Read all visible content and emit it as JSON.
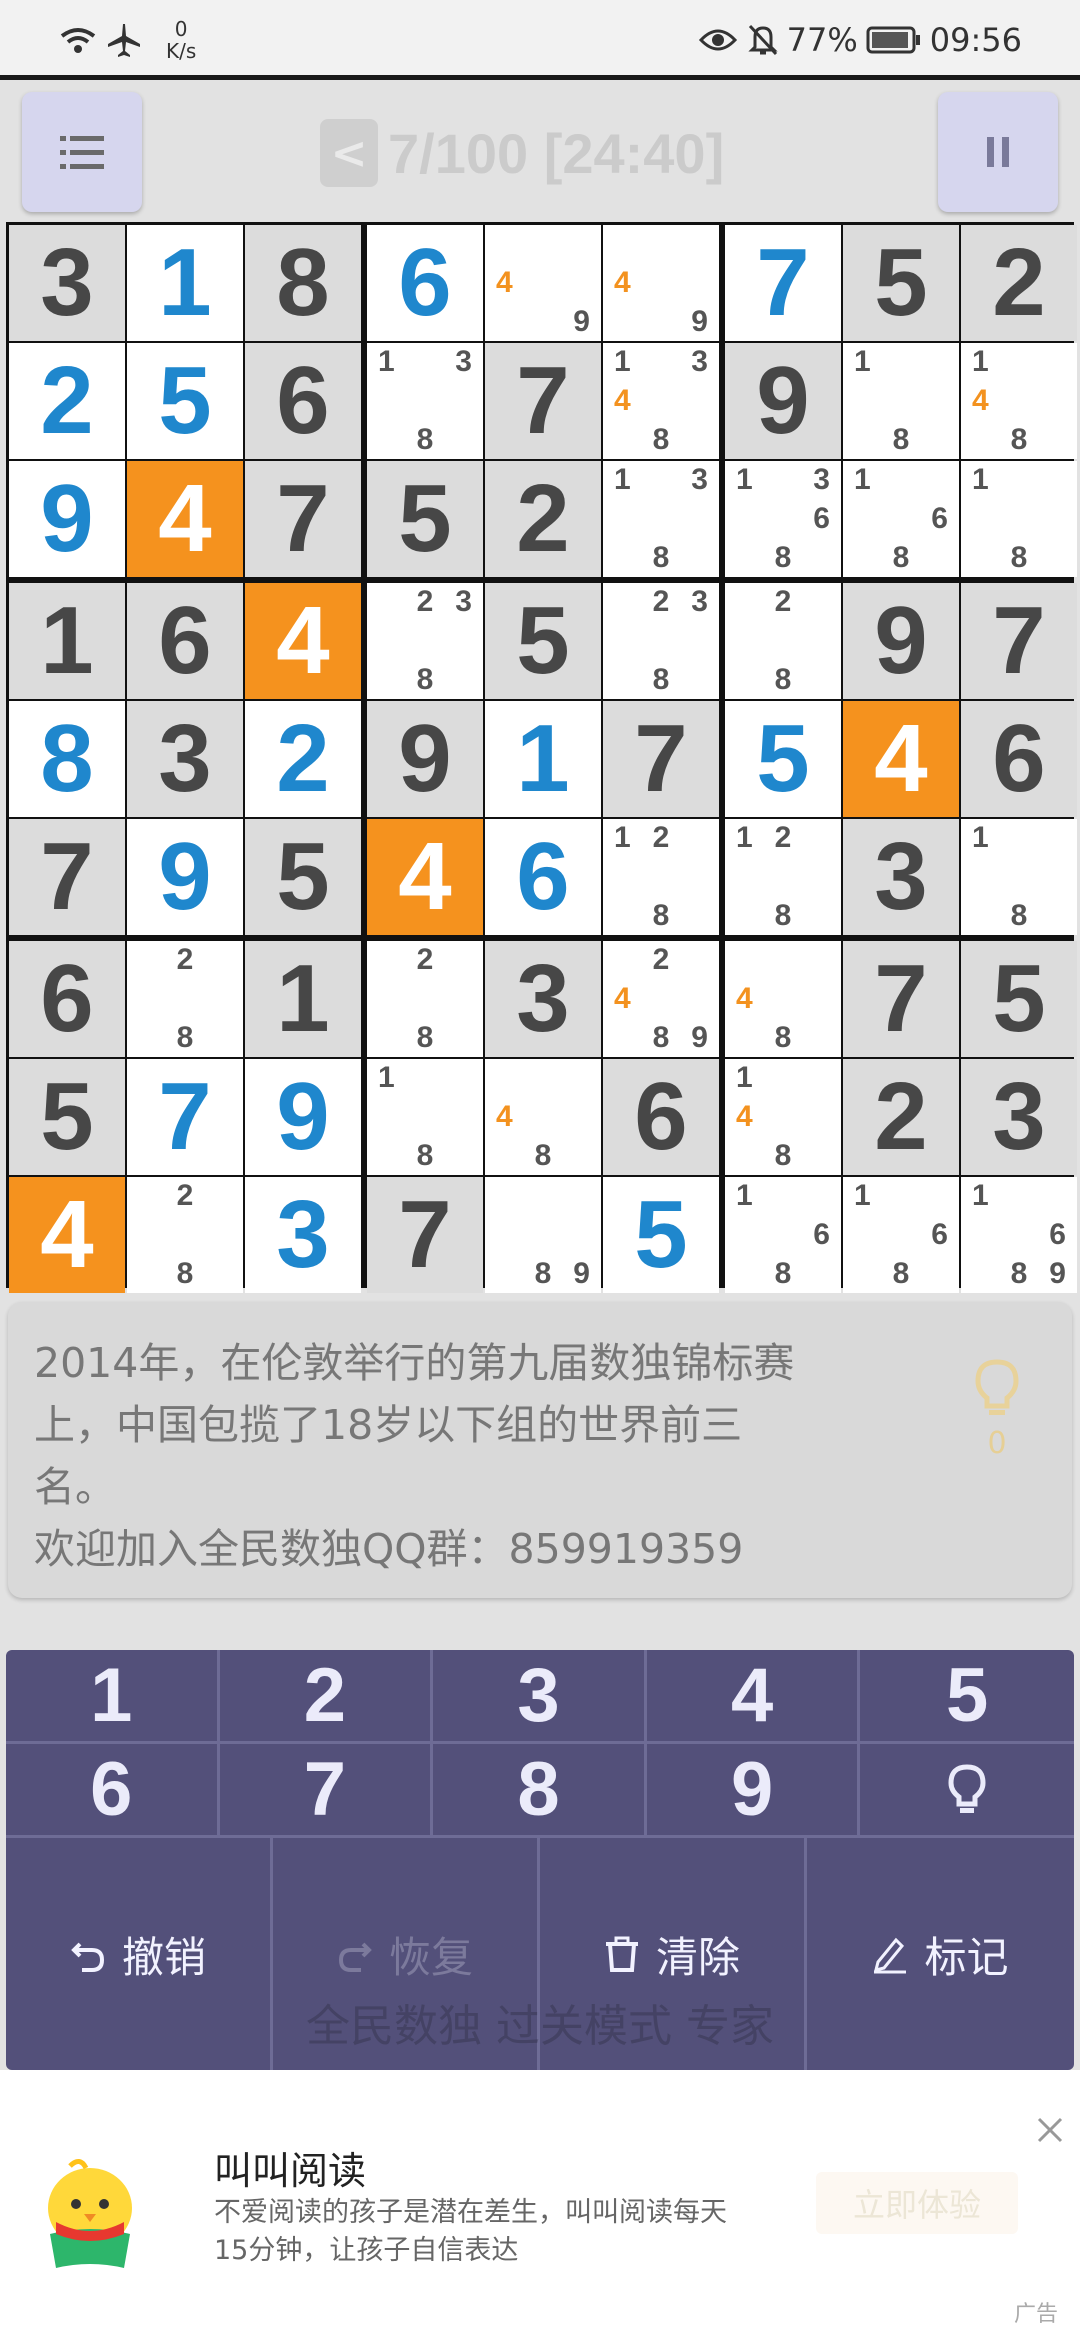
{
  "status_bar": {
    "net_speed_value": "0",
    "net_speed_unit": "K/s",
    "battery": "77%",
    "time": "09:56"
  },
  "header": {
    "back_label": "<",
    "progress": "7/100 [24:40]"
  },
  "board": {
    "cells": [
      [
        {
          "v": "3",
          "g": 1
        },
        {
          "v": "1",
          "u": 1
        },
        {
          "v": "8",
          "g": 1
        },
        {
          "v": "6",
          "u": 1
        },
        {
          "n": [
            4,
            9
          ]
        },
        {
          "n": [
            4,
            9
          ]
        },
        {
          "v": "7",
          "u": 1
        },
        {
          "v": "5",
          "g": 1
        },
        {
          "v": "2",
          "g": 1
        }
      ],
      [
        {
          "v": "2",
          "u": 1
        },
        {
          "v": "5",
          "u": 1
        },
        {
          "v": "6",
          "g": 1
        },
        {
          "n": [
            1,
            3,
            8
          ]
        },
        {
          "v": "7",
          "g": 1
        },
        {
          "n": [
            1,
            3,
            4,
            8
          ]
        },
        {
          "v": "9",
          "g": 1
        },
        {
          "n": [
            1,
            8
          ]
        },
        {
          "n": [
            1,
            4,
            8
          ]
        }
      ],
      [
        {
          "v": "9",
          "u": 1
        },
        {
          "v": "4",
          "h": 1
        },
        {
          "v": "7",
          "g": 1
        },
        {
          "v": "5",
          "g": 1
        },
        {
          "v": "2",
          "g": 1
        },
        {
          "n": [
            1,
            3,
            8
          ]
        },
        {
          "n": [
            1,
            3,
            6,
            8
          ]
        },
        {
          "n": [
            1,
            6,
            8
          ]
        },
        {
          "n": [
            1,
            8
          ]
        }
      ],
      [
        {
          "v": "1",
          "g": 1
        },
        {
          "v": "6",
          "g": 1
        },
        {
          "v": "4",
          "h": 1
        },
        {
          "n": [
            2,
            3,
            8
          ]
        },
        {
          "v": "5",
          "g": 1
        },
        {
          "n": [
            2,
            3,
            8
          ]
        },
        {
          "n": [
            2,
            8
          ]
        },
        {
          "v": "9",
          "g": 1
        },
        {
          "v": "7",
          "g": 1
        }
      ],
      [
        {
          "v": "8",
          "u": 1
        },
        {
          "v": "3",
          "g": 1
        },
        {
          "v": "2",
          "u": 1
        },
        {
          "v": "9",
          "g": 1
        },
        {
          "v": "1",
          "u": 1
        },
        {
          "v": "7",
          "g": 1
        },
        {
          "v": "5",
          "u": 1
        },
        {
          "v": "4",
          "h": 1
        },
        {
          "v": "6",
          "g": 1
        }
      ],
      [
        {
          "v": "7",
          "g": 1
        },
        {
          "v": "9",
          "u": 1
        },
        {
          "v": "5",
          "g": 1
        },
        {
          "v": "4",
          "h": 1
        },
        {
          "v": "6",
          "u": 1
        },
        {
          "n": [
            1,
            2,
            8
          ]
        },
        {
          "n": [
            1,
            2,
            8
          ]
        },
        {
          "v": "3",
          "g": 1
        },
        {
          "n": [
            1,
            8
          ]
        }
      ],
      [
        {
          "v": "6",
          "g": 1
        },
        {
          "n": [
            2,
            8
          ]
        },
        {
          "v": "1",
          "g": 1
        },
        {
          "n": [
            2,
            8
          ]
        },
        {
          "v": "3",
          "g": 1
        },
        {
          "n": [
            2,
            4,
            8,
            9
          ]
        },
        {
          "n": [
            4,
            8
          ]
        },
        {
          "v": "7",
          "g": 1
        },
        {
          "v": "5",
          "g": 1
        }
      ],
      [
        {
          "v": "5",
          "g": 1
        },
        {
          "v": "7",
          "u": 1
        },
        {
          "v": "9",
          "u": 1
        },
        {
          "n": [
            1,
            8
          ]
        },
        {
          "n": [
            4,
            8
          ]
        },
        {
          "v": "6",
          "g": 1
        },
        {
          "n": [
            1,
            4,
            8
          ]
        },
        {
          "v": "2",
          "g": 1
        },
        {
          "v": "3",
          "g": 1
        }
      ],
      [
        {
          "v": "4",
          "h": 1
        },
        {
          "n": [
            2,
            8
          ]
        },
        {
          "v": "3",
          "u": 1
        },
        {
          "v": "7",
          "g": 1
        },
        {
          "n": [
            8,
            9
          ]
        },
        {
          "v": "5",
          "u": 1
        },
        {
          "n": [
            1,
            6,
            8
          ]
        },
        {
          "n": [
            1,
            6,
            8
          ]
        },
        {
          "n": [
            1,
            6,
            8,
            9
          ]
        }
      ]
    ],
    "highlight_digit": 4,
    "colors": {
      "given_bg": "#dcdcdc",
      "empty_bg": "#ffffff",
      "highlight_bg": "#f5921e",
      "given_text": "#474747",
      "user_text": "#1f87cd",
      "highlight_text": "#ffffff"
    }
  },
  "info": {
    "text_line1": "2014年，在伦敦举行的第九届数独锦标赛",
    "text_line2": "上，中国包揽了18岁以下组的世界前三",
    "text_line3": "名。",
    "text_line4": "欢迎加入全民数独QQ群：859919359",
    "hint_count": "0"
  },
  "keypad": {
    "digits": [
      "1",
      "2",
      "3",
      "4",
      "5",
      "6",
      "7",
      "8",
      "9"
    ],
    "actions": {
      "undo": "撤销",
      "redo": "恢复",
      "clear": "清除",
      "mark": "标记"
    },
    "watermark": "全民数独 过关模式 专家"
  },
  "ad": {
    "title": "叫叫阅读",
    "desc_line1": "不爱阅读的孩子是潜在差生，叫叫阅读每天",
    "desc_line2": "15分钟，让孩子自信表达",
    "cta": "立即体验",
    "label": "广告"
  }
}
